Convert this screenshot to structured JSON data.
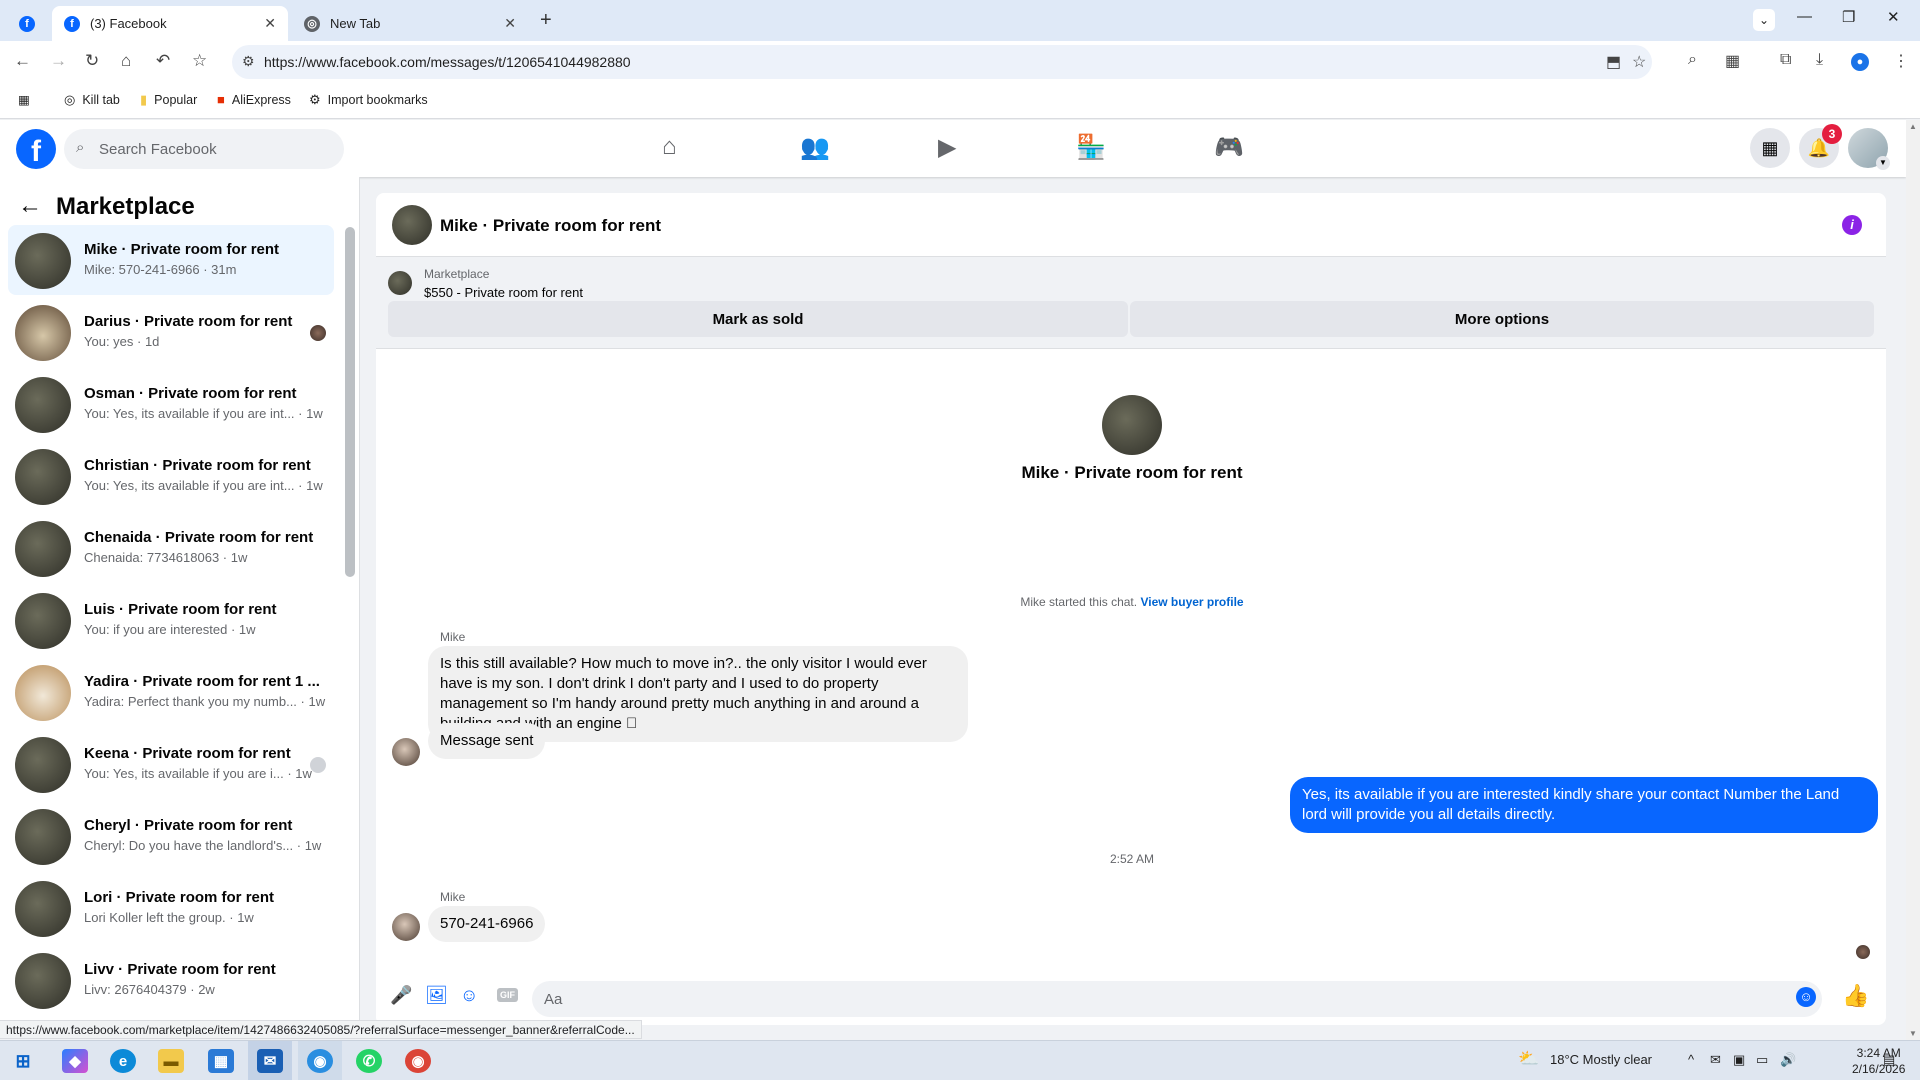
{
  "browser": {
    "tabs": [
      {
        "label": "(3) Facebook"
      },
      {
        "label": "New Tab"
      }
    ],
    "url": "https://www.facebook.com/messages/t/1206541044982880",
    "bookmarks": [
      {
        "label": "Kill tab"
      },
      {
        "label": "Popular"
      },
      {
        "label": "AliExpress"
      },
      {
        "label": "Import bookmarks"
      }
    ],
    "status_url": "https://www.facebook.com/marketplace/item/1427486632405085/?referralSurface=messenger_banner&referralCode..."
  },
  "fb": {
    "search_placeholder": "Search Facebook",
    "notification_count": "3",
    "brand_color": "#0866ff"
  },
  "sidebar": {
    "title": "Marketplace",
    "conversations": [
      {
        "name": "Mike · Private room for rent",
        "preview": "Mike: 570-241-6966 · 31m"
      },
      {
        "name": "Darius · Private room for rent",
        "preview": "You: yes · 1d"
      },
      {
        "name": "Osman · Private room for rent",
        "preview": "You: Yes, its available if you are int... · 1w"
      },
      {
        "name": "Christian · Private room for rent",
        "preview": "You: Yes, its available if you are int... · 1w"
      },
      {
        "name": "Chenaida · Private room for rent",
        "preview": "Chenaida: 7734618063 · 1w"
      },
      {
        "name": "Luis · Private room for rent",
        "preview": "You: if you are interested · 1w"
      },
      {
        "name": "Yadira · Private room for rent 1 ...",
        "preview": "Yadira: Perfect thank you my numb... · 1w"
      },
      {
        "name": "Keena · Private room for rent",
        "preview": "You: Yes, its available if you are i... · 1w"
      },
      {
        "name": "Cheryl · Private room for rent",
        "preview": "Cheryl: Do you have the landlord's... · 1w"
      },
      {
        "name": "Lori · Private room for rent",
        "preview": "Lori Koller left the group. · 1w"
      },
      {
        "name": "Livv · Private room for rent",
        "preview": "Livv: 2676404379 · 2w"
      }
    ]
  },
  "chat": {
    "title": "Mike · Private room for rent",
    "banner": {
      "label": "Marketplace",
      "listing": "$550 - Private room for rent",
      "mark_sold": "Mark as sold",
      "more_options": "More options"
    },
    "intro_name": "Mike · Private room for rent",
    "started_text": "Mike started this chat.",
    "view_buyer": "View buyer profile",
    "messages": [
      {
        "sender": "Mike",
        "text": "Is this still available? How much to move in?.. the only visitor I would ever have is my son. I don't drink I don't party and I used to do property management so I'm handy around pretty much anything in and around a building and with an engine 🏼"
      },
      {
        "text": "Message sent"
      },
      {
        "text": "Yes, its available if you are interested kindly share your contact Number the Land lord will provide you all details directly."
      },
      {
        "time": "2:52 AM"
      },
      {
        "sender": "Mike",
        "text": "570-241-6966"
      }
    ],
    "composer_placeholder": "Aa"
  },
  "taskbar": {
    "weather": "18°C  Mostly clear",
    "time": "3:24 AM",
    "date": "2/16/2026"
  }
}
